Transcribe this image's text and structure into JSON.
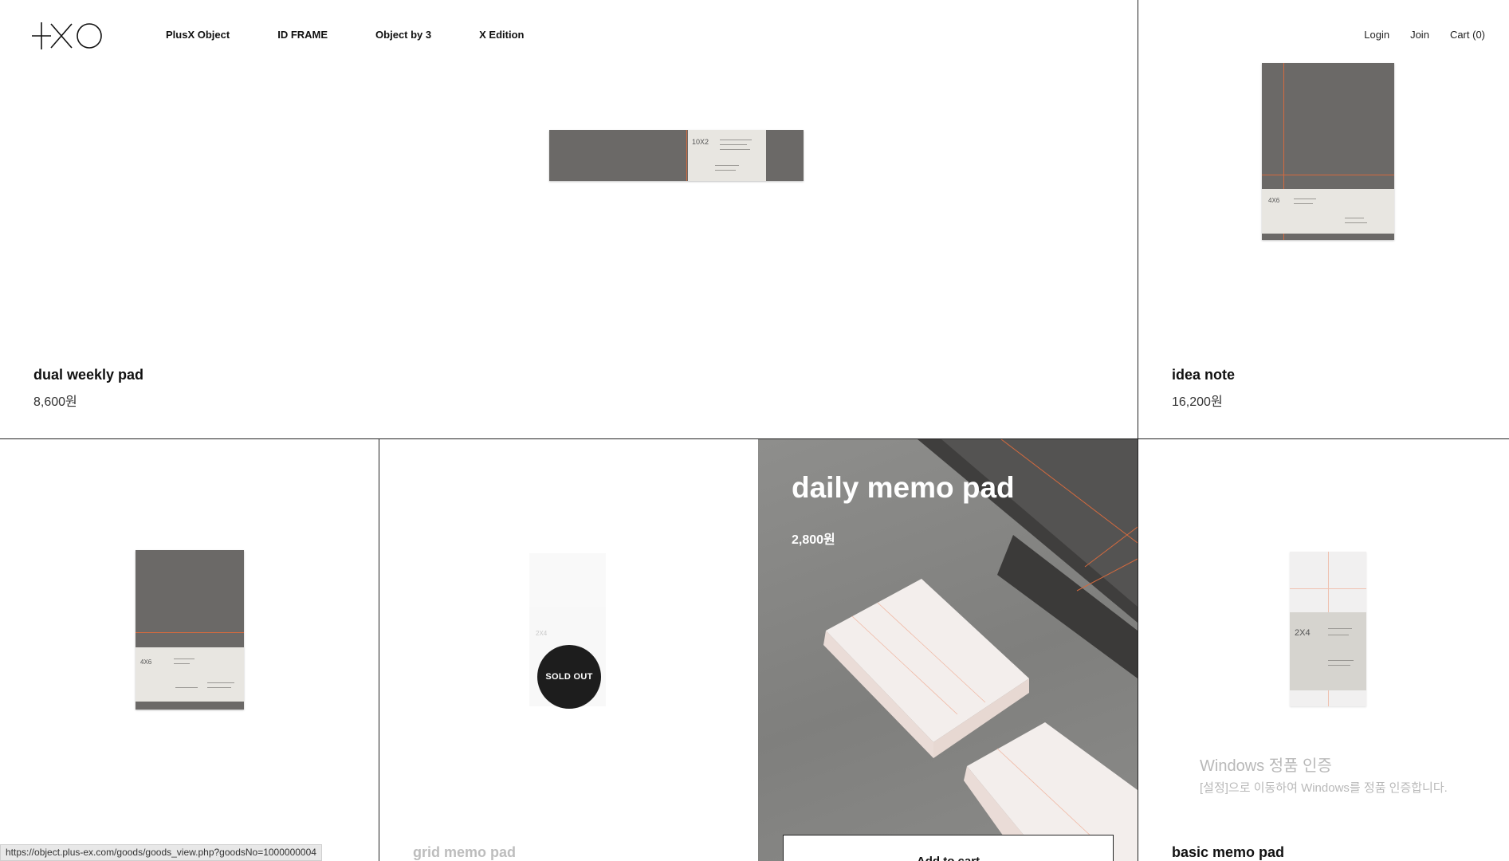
{
  "header": {
    "logo_alt": "+XO",
    "nav": [
      "PlusX Object",
      "ID FRAME",
      "Object by 3",
      "X Edition"
    ],
    "util": [
      "Login",
      "Join",
      "Cart (0)"
    ]
  },
  "products": {
    "dual_weekly": {
      "name": "dual weekly pad",
      "price": "8,600원",
      "label": "10X2"
    },
    "idea_note": {
      "name": "idea note",
      "price": "16,200원",
      "label": "4X6"
    },
    "notebook": {
      "label": "4X6"
    },
    "grid_memo": {
      "name": "grid memo pad",
      "label": "2X4",
      "badge": "SOLD OUT"
    },
    "daily_memo": {
      "name": "daily memo pad",
      "price": "2,800원",
      "cta": "Add to cart"
    },
    "basic_memo": {
      "name": "basic memo pad",
      "label": "2X4"
    }
  },
  "watermark": {
    "line1": "Windows 정품 인증",
    "line2": "[설정]으로 이동하여 Windows를 정품 인증합니다."
  },
  "statusbar": {
    "url": "https://object.plus-ex.com/goods/goods_view.php?goodsNo=1000000004"
  }
}
